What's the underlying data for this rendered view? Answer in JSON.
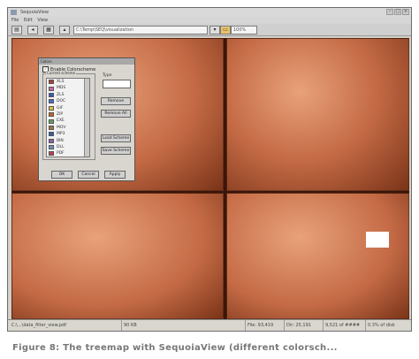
{
  "window": {
    "title": "SequoiaView",
    "path": "C:\\Temp\\SEQ\\visualization",
    "zoom": "100%"
  },
  "menubar": {
    "items": [
      "File",
      "Edit",
      "View"
    ]
  },
  "statusbar": {
    "path": "C:\\...\\data_filter_view.pdf",
    "size": "90 KB",
    "count": "File: 93,419",
    "time": "Dir: 25,191",
    "extra": "9,521 of ####",
    "free": "0.3% of disk"
  },
  "dialog": {
    "title": "Colors",
    "enable_label": "Enable Colorscheme",
    "group_label": "Current scheme",
    "type_label": "Type",
    "ext_items": [
      {
        "label": "XLS",
        "color": "#b04030"
      },
      {
        "label": "MDS",
        "color": "#c86aa0"
      },
      {
        "label": "ZLS",
        "color": "#3a56b8"
      },
      {
        "label": "DOC",
        "color": "#4a6ad0"
      },
      {
        "label": "GIF",
        "color": "#e0c040"
      },
      {
        "label": "ZIP",
        "color": "#d06020"
      },
      {
        "label": "EXE",
        "color": "#60a060"
      },
      {
        "label": "MOV",
        "color": "#a07040"
      },
      {
        "label": "MP3",
        "color": "#3060a0"
      },
      {
        "label": "BIN",
        "color": "#9060b0"
      },
      {
        "label": "DLL",
        "color": "#7090c0"
      },
      {
        "label": "PDF",
        "color": "#c04050"
      }
    ],
    "btn_remove": "Remove",
    "btn_remove_all": "Remove All",
    "btn_load": "Load Scheme",
    "btn_save": "Save Scheme",
    "btn_ok": "OK",
    "btn_cancel": "Cancel",
    "btn_apply": "Apply"
  },
  "caption": "Figure 8:  The treemap with SequoiaView (different colorsch...",
  "colors": {
    "copper": "#c46a45",
    "copper_light": "#e8a27a",
    "copper_dark": "#7a3418",
    "blue": "#4a5fc0",
    "pale": "#dcc8c8"
  }
}
